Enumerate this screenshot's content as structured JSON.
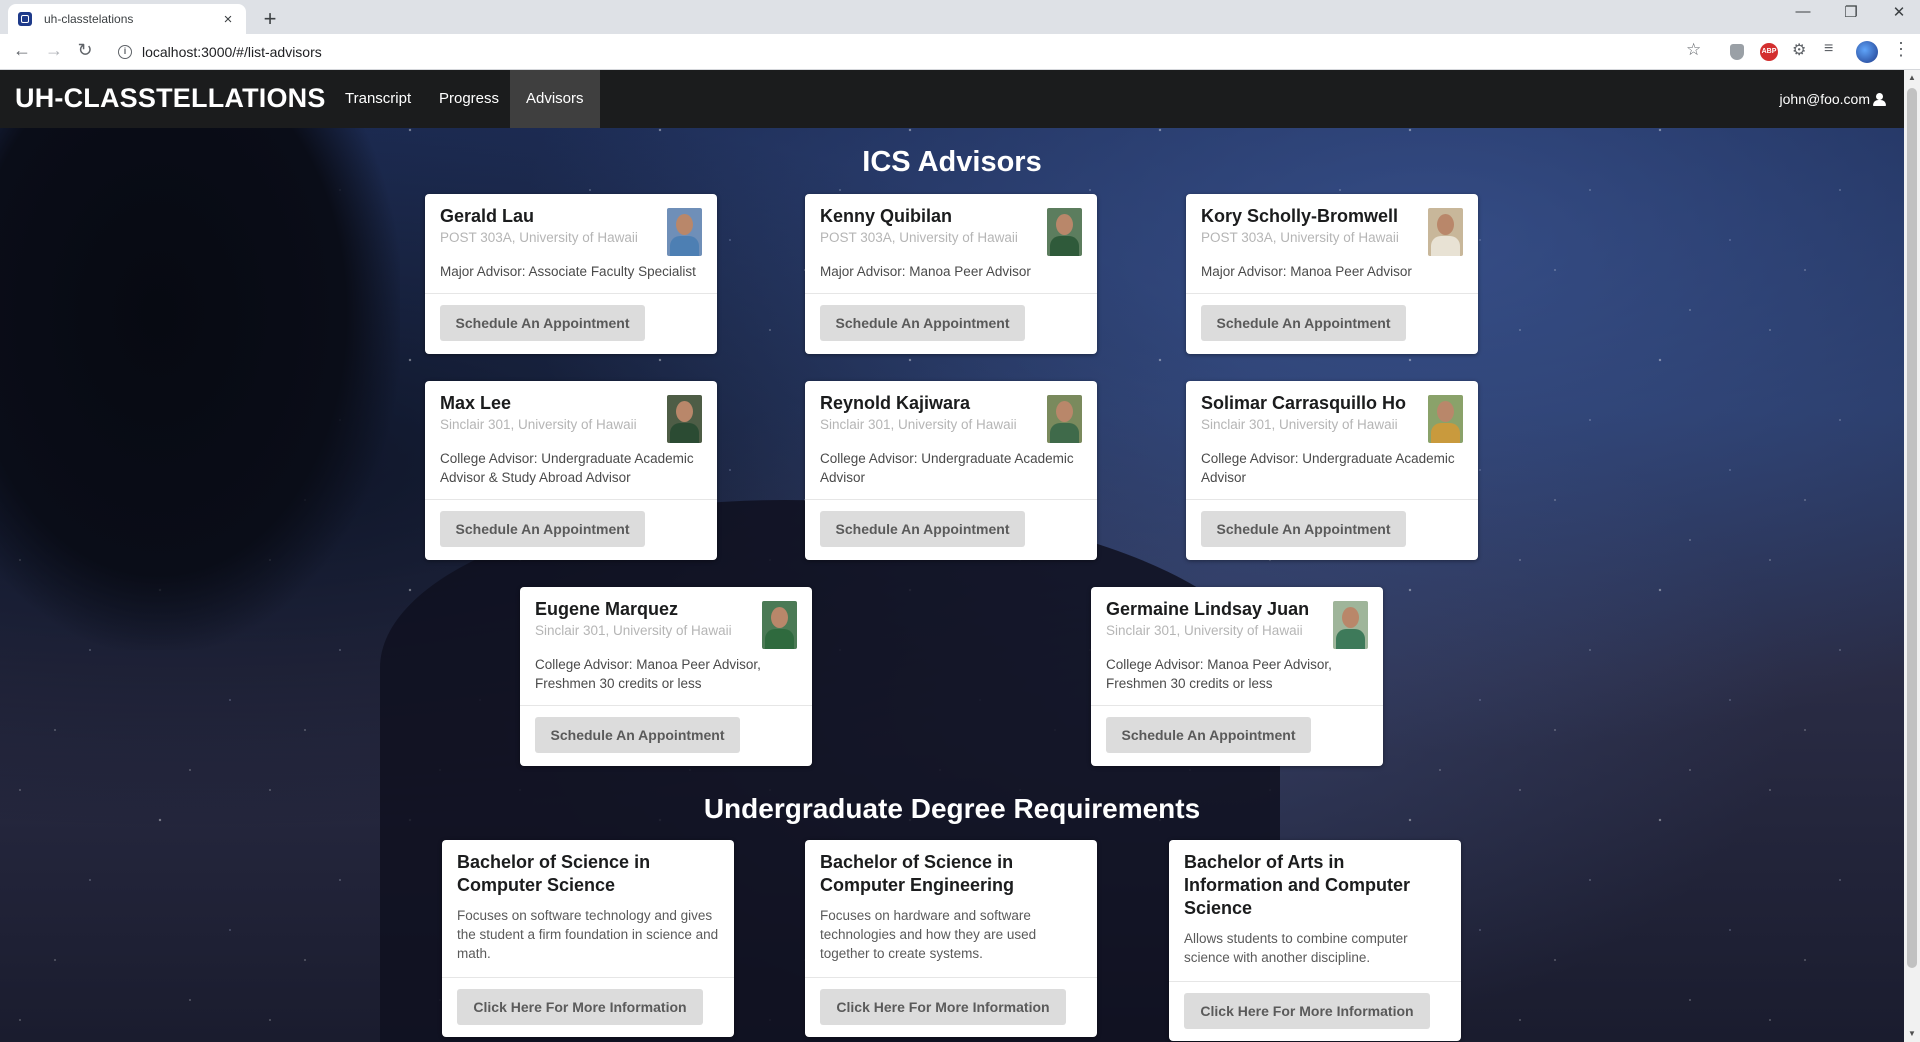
{
  "browser": {
    "tab_title": "uh-classtelations",
    "tab_close": "×",
    "new_tab": "+",
    "url": "localhost:3000/#/list-advisors",
    "ext_abp": "ABP"
  },
  "navbar": {
    "brand": "UH-CLASSTELLATIONS",
    "items": [
      "Transcript",
      "Progress",
      "Advisors"
    ],
    "active": "Advisors",
    "user": "john@foo.com"
  },
  "advisors_section": {
    "title": "ICS Advisors",
    "button_label": "Schedule An Appointment",
    "advisors": [
      {
        "name": "Gerald Lau",
        "location": "POST 303A, University of Hawaii",
        "role": "Major Advisor: Associate Faculty Specialist",
        "photo_bg": "#6f8fb8",
        "photo_shirt": "#4d7fb3"
      },
      {
        "name": "Kenny Quibilan",
        "location": "POST 303A, University of Hawaii",
        "role": "Major Advisor: Manoa Peer Advisor",
        "photo_bg": "#5c7d5e",
        "photo_shirt": "#2f5a3a"
      },
      {
        "name": "Kory Scholly-Bromwell",
        "location": "POST 303A, University of Hawaii",
        "role": "Major Advisor: Manoa Peer Advisor",
        "photo_bg": "#c8b79a",
        "photo_shirt": "#e8e2d4"
      },
      {
        "name": "Max Lee",
        "location": "Sinclair 301, University of Hawaii",
        "role": "College Advisor: Undergraduate Academic Advisor & Study Abroad Advisor",
        "photo_bg": "#4e5d46",
        "photo_shirt": "#2b4b33"
      },
      {
        "name": "Reynold Kajiwara",
        "location": "Sinclair 301, University of Hawaii",
        "role": "College Advisor: Undergraduate Academic Advisor",
        "photo_bg": "#7a8a5d",
        "photo_shirt": "#3f6a4a"
      },
      {
        "name": "Solimar Carrasquillo Ho",
        "location": "Sinclair 301, University of Hawaii",
        "role": "College Advisor: Undergraduate Academic Advisor",
        "photo_bg": "#8aa26a",
        "photo_shirt": "#c99a3d"
      },
      {
        "name": "Eugene Marquez",
        "location": "Sinclair 301, University of Hawaii",
        "role": "College Advisor: Manoa Peer Advisor, Freshmen 30 credits or less",
        "photo_bg": "#4b7a55",
        "photo_shirt": "#2f6a3e"
      },
      {
        "name": "Germaine Lindsay Juan",
        "location": "Sinclair 301, University of Hawaii",
        "role": "College Advisor: Manoa Peer Advisor, Freshmen 30 credits or less",
        "photo_bg": "#9fb59a",
        "photo_shirt": "#3e7a5a"
      }
    ]
  },
  "degrees_section": {
    "title": "Undergraduate Degree Requirements",
    "button_label": "Click Here For More Information",
    "degrees": [
      {
        "title": "Bachelor of Science in Computer Science",
        "description": "Focuses on software technology and gives the student a firm foundation in science and math."
      },
      {
        "title": "Bachelor of Science in Computer Engineering",
        "description": "Focuses on hardware and software technologies and how they are used together to create systems."
      },
      {
        "title": "Bachelor of Arts in Information and Computer Science",
        "description": "Allows students to combine computer science with another discipline."
      }
    ]
  }
}
